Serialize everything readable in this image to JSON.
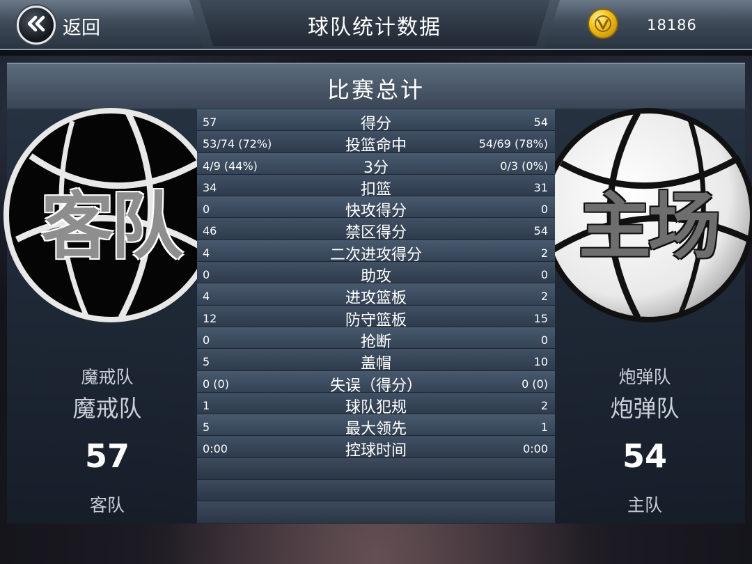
{
  "header": {
    "back_label": "返回",
    "title": "球队统计数据",
    "coins": "18186"
  },
  "panel": {
    "title": "比赛总计"
  },
  "away": {
    "logo_text": "客队",
    "name_small": "魔戒队",
    "name_big": "魔戒队",
    "score": "57",
    "role": "客队"
  },
  "home": {
    "logo_text": "主场",
    "name_small": "炮弹队",
    "name_big": "炮弹队",
    "score": "54",
    "role": "主队"
  },
  "stats": [
    {
      "label": "得分",
      "away": "57",
      "home": "54"
    },
    {
      "label": "投篮命中",
      "away": "53/74 (72%)",
      "home": "54/69 (78%)"
    },
    {
      "label": "3分",
      "away": "4/9 (44%)",
      "home": "0/3 (0%)"
    },
    {
      "label": "扣篮",
      "away": "34",
      "home": "31"
    },
    {
      "label": "快攻得分",
      "away": "0",
      "home": "0"
    },
    {
      "label": "禁区得分",
      "away": "46",
      "home": "54"
    },
    {
      "label": "二次进攻得分",
      "away": "4",
      "home": "2"
    },
    {
      "label": "助攻",
      "away": "0",
      "home": "0"
    },
    {
      "label": "进攻篮板",
      "away": "4",
      "home": "2"
    },
    {
      "label": "防守篮板",
      "away": "12",
      "home": "15"
    },
    {
      "label": "抢断",
      "away": "0",
      "home": "0"
    },
    {
      "label": "盖帽",
      "away": "5",
      "home": "10"
    },
    {
      "label": "失误（得分）",
      "away": "0 (0)",
      "home": "0 (0)"
    },
    {
      "label": "球队犯规",
      "away": "1",
      "home": "2"
    },
    {
      "label": "最大领先",
      "away": "5",
      "home": "1"
    },
    {
      "label": "控球时间",
      "away": "0:00",
      "home": "0:00"
    }
  ],
  "icons": {
    "back": "double-chevron-left-icon",
    "coin": "gold-coin-icon"
  },
  "colors": {
    "coin": "#f2c21a",
    "panel": "#283444"
  }
}
